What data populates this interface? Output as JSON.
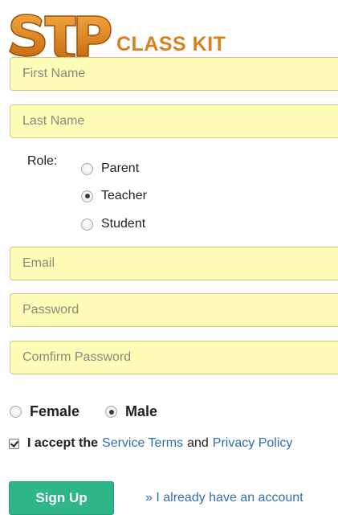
{
  "logo": {
    "mark": "STP",
    "text": "CLASS KIT",
    "color": "#d8821f"
  },
  "form": {
    "first_name_placeholder": "First Name",
    "last_name_placeholder": "Last Name",
    "email_placeholder": "Email",
    "password_placeholder": "Password",
    "confirm_password_placeholder": "Comfirm Password",
    "field_background": "#fefcb6"
  },
  "role": {
    "label": "Role:",
    "options": [
      {
        "label": "Parent",
        "checked": false
      },
      {
        "label": "Teacher",
        "checked": true
      },
      {
        "label": "Student",
        "checked": false
      }
    ]
  },
  "gender": {
    "options": [
      {
        "label": "Female",
        "checked": false
      },
      {
        "label": "Male",
        "checked": true
      }
    ]
  },
  "terms": {
    "checked": true,
    "prefix": "I accept the",
    "service_terms_link": "Service Terms",
    "and": "and",
    "privacy_policy_link": "Privacy Policy",
    "link_color": "#2f6fb0"
  },
  "actions": {
    "signup_label": "Sign Up",
    "signup_color": "#2fb58a",
    "have_account_link": "» I already have an account"
  }
}
